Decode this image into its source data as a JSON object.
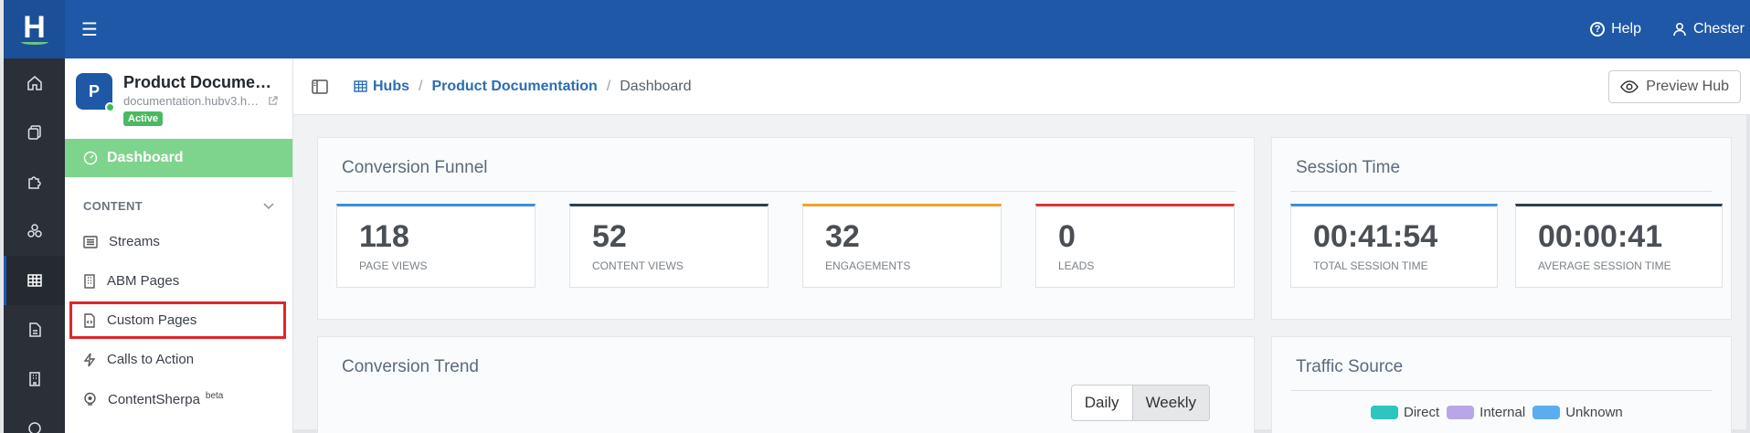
{
  "topbar": {
    "logo_letter": "H",
    "help_label": "Help",
    "user_label": "Chester"
  },
  "rail": {
    "items": [
      "home-icon",
      "copy-icon",
      "puzzle-icon",
      "network-icon",
      "grid-icon",
      "document-icon",
      "building-icon",
      "pin-icon"
    ],
    "active_index": 4
  },
  "hub": {
    "avatar_letter": "P",
    "title": "Product Documentation",
    "url": "documentation.hubv3.hubs...",
    "status": "Active"
  },
  "sidebar": {
    "dashboard_label": "Dashboard",
    "section_label": "CONTENT",
    "items": [
      {
        "label": "Streams",
        "icon": "list-icon"
      },
      {
        "label": "ABM Pages",
        "icon": "building-icon"
      },
      {
        "label": "Custom Pages",
        "icon": "code-file-icon"
      },
      {
        "label": "Calls to Action",
        "icon": "bolt-icon"
      },
      {
        "label": "ContentSherpa",
        "icon": "sherpa-icon",
        "badge": "beta"
      }
    ]
  },
  "breadcrumb": {
    "hubs": "Hubs",
    "hub": "Product Documentation",
    "current": "Dashboard"
  },
  "preview_label": "Preview Hub",
  "funnel": {
    "title": "Conversion Funnel",
    "stats": [
      {
        "value": "118",
        "label": "PAGE VIEWS",
        "color": "#3a8fd9"
      },
      {
        "value": "52",
        "label": "CONTENT VIEWS",
        "color": "#2d3e4f"
      },
      {
        "value": "32",
        "label": "ENGAGEMENTS",
        "color": "#f0a030"
      },
      {
        "value": "0",
        "label": "LEADS",
        "color": "#e0343a"
      }
    ]
  },
  "session": {
    "title": "Session Time",
    "stats": [
      {
        "value": "00:41:54",
        "label": "TOTAL SESSION TIME",
        "color": "#3a8fd9"
      },
      {
        "value": "00:00:41",
        "label": "AVERAGE SESSION TIME",
        "color": "#2d3e4f"
      }
    ]
  },
  "trend": {
    "title": "Conversion Trend",
    "daily_label": "Daily",
    "weekly_label": "Weekly"
  },
  "traffic": {
    "title": "Traffic Source",
    "legend": [
      {
        "label": "Direct",
        "color": "#2ec4bf"
      },
      {
        "label": "Internal",
        "color": "#b9a6e6"
      },
      {
        "label": "Unknown",
        "color": "#5aaeef"
      }
    ]
  }
}
